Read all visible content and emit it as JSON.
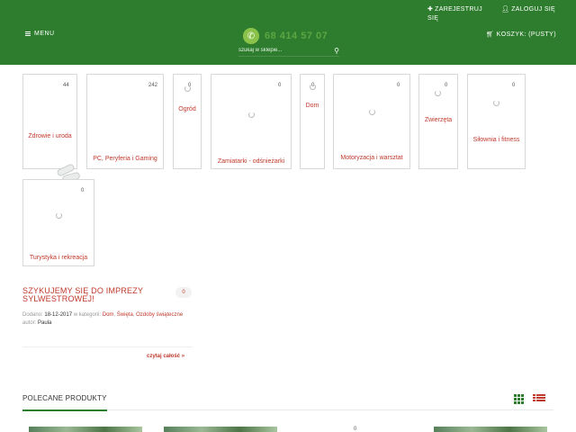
{
  "header": {
    "menu_label": "MENU",
    "register_icon": "plus-icon",
    "register_label": "ZAREJESTRUJ SIĘ",
    "login_icon": "user-icon",
    "login_label": "ZALOGUJ SIĘ",
    "phone_icon": "phone-icon",
    "phone_number": "68 414 57 07",
    "search_placeholder": "szukaj w sklepie...",
    "search_icon": "search-icon",
    "cart_icon": "basket-icon",
    "cart_label": "KOSZYK: (PUSTY)",
    "colors": {
      "bar": "#2e7d2e",
      "accent": "#c0392b"
    }
  },
  "categories": [
    {
      "name": "Zdrowie i uroda",
      "count": "44"
    },
    {
      "name": "PC, Peryferia i Gaming",
      "count": "242"
    },
    {
      "name": "Ogród",
      "count": "0"
    },
    {
      "name": "Zamiatarki - odśnieżarki",
      "count": "0"
    },
    {
      "name": "Dom",
      "count": "0"
    },
    {
      "name": "Motoryzacja i warsztat",
      "count": "0"
    },
    {
      "name": "Zwierzęta",
      "count": "0"
    },
    {
      "name": "Siłownia i fitness",
      "count": "0"
    },
    {
      "name": "Turystyka i rekreacja",
      "count": "0"
    }
  ],
  "blog": {
    "title": "SZYKUJEMY SIĘ DO IMPREZY SYLWESTROWEJ!",
    "comments": "0",
    "added_label": "Dodano:",
    "date": "18-12-2017",
    "in_category_label": "w kategorii:",
    "cat1": "Dom",
    "cat2": "Święta",
    "cat3": "Ozdoby świąteczne",
    "author_label": "autor:",
    "author": "Paula",
    "read_more": "czytaj całość »"
  },
  "featured": {
    "title": "POLECANE PRODUKTY",
    "grid_view_icon": "grid-view-icon",
    "list_view_icon": "list-view-icon",
    "badge": "0"
  }
}
